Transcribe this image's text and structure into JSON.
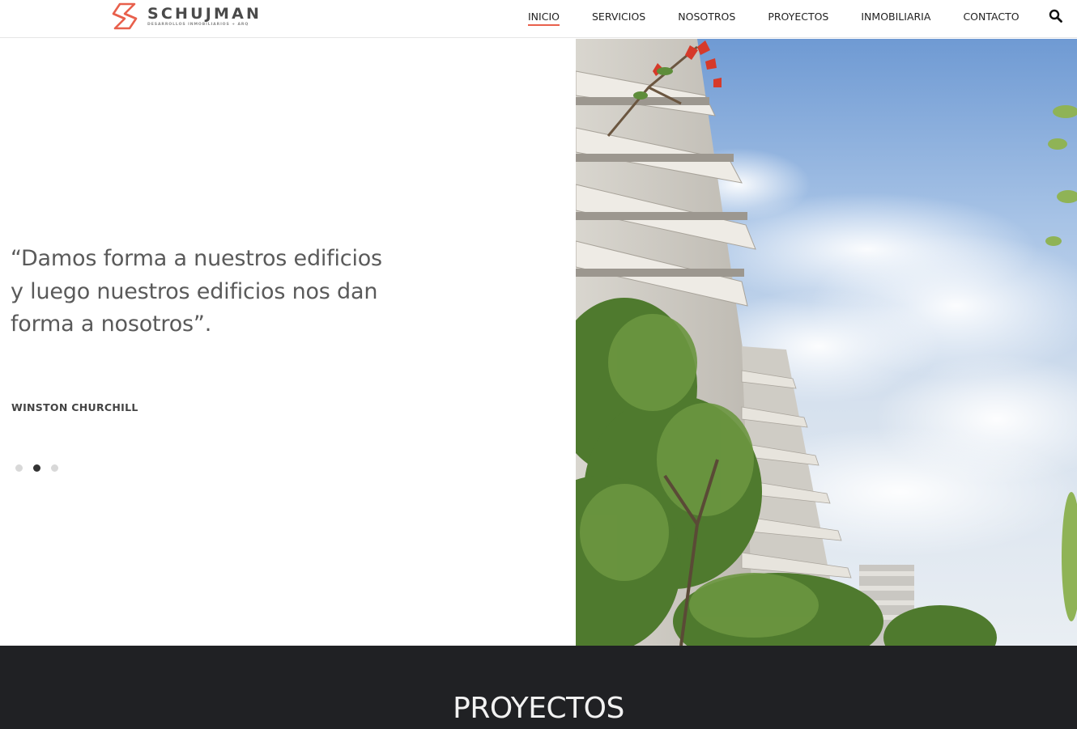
{
  "header": {
    "logo": {
      "name": "SCHUJMAN",
      "tagline": "DESARROLLOS INMOBILIARIOS + ARQ",
      "mark_icon": "schujman-s-logo-icon",
      "brand_color": "#e8604c"
    },
    "nav": [
      {
        "label": "INICIO",
        "active": true
      },
      {
        "label": "SERVICIOS",
        "active": false
      },
      {
        "label": "NOSOTROS",
        "active": false
      },
      {
        "label": "PROYECTOS",
        "active": false
      },
      {
        "label": "INMOBILIARIA",
        "active": false
      },
      {
        "label": "CONTACTO",
        "active": false
      }
    ],
    "search_icon": "search-icon"
  },
  "hero": {
    "quote": "“Damos forma a nuestros edificios y luego nuestros edificios nos dan forma a nosotros”.",
    "author": "WINSTON CHURCHILL",
    "slider": {
      "total": 3,
      "current": 2
    },
    "image": "building-render-with-trees-and-sky"
  },
  "projects": {
    "title": "PROYECTOS",
    "background": "#202124"
  }
}
